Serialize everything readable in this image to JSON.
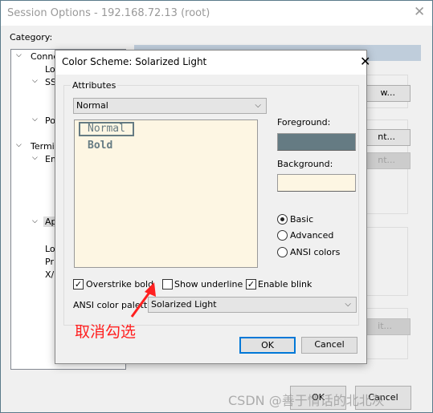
{
  "window": {
    "title": "Session Options - 192.168.72.13 (root)",
    "category_label": "Category:",
    "tree": [
      "Conne",
      "Lo",
      "SS",
      "Po",
      "Termi",
      "Em",
      "Ap",
      "Lo",
      "Pri",
      "X/"
    ],
    "bg_buttons": [
      "w...",
      "nt...",
      "nt...",
      "it..."
    ],
    "ok": "OK",
    "cancel": "Cancel"
  },
  "dialog": {
    "title": "Color Scheme: Solarized Light",
    "group_label": "Attributes",
    "attribute_select": "Normal",
    "preview_normal": "Normal",
    "preview_bold": "Bold",
    "foreground_label": "Foreground:",
    "background_label": "Background:",
    "foreground_color": "#657b83",
    "background_color": "#fdf6e3",
    "radios": [
      {
        "label": "Basic",
        "checked": true
      },
      {
        "label": "Advanced",
        "checked": false
      },
      {
        "label": "ANSI colors",
        "checked": false
      }
    ],
    "checkboxes": [
      {
        "label": "Overstrike bold",
        "checked": true
      },
      {
        "label": "Show underline",
        "checked": false
      },
      {
        "label": "Enable blink",
        "checked": true
      }
    ],
    "palette_label": "ANSI color palette:",
    "palette_value": "Solarized Light",
    "ok": "OK",
    "cancel": "Cancel"
  },
  "annotation": {
    "text": "取消勾选",
    "color": "#ff2020"
  },
  "watermark": "CSDN @善于情话的北北灰"
}
